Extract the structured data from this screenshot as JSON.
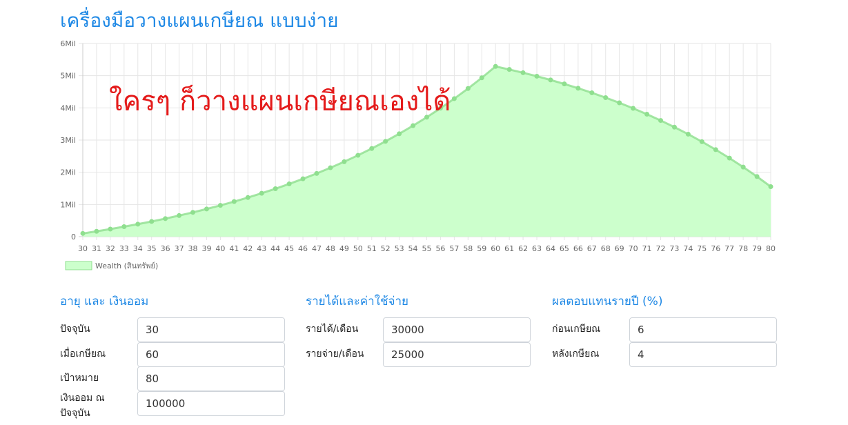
{
  "page": {
    "title": "เครื่องมือวางแผนเกษียณ แบบง่าย",
    "overlay_text": "ใครๆ ก็วางแผนเกษียณเองได้"
  },
  "chart_data": {
    "type": "area",
    "xlabel": "",
    "ylabel": "",
    "ylim": [
      0,
      6000000
    ],
    "y_ticks": [
      "0",
      "1Mil",
      "2Mil",
      "3Mil",
      "4Mil",
      "5Mil",
      "6Mil"
    ],
    "x": [
      30,
      31,
      32,
      33,
      34,
      35,
      36,
      37,
      38,
      39,
      40,
      41,
      42,
      43,
      44,
      45,
      46,
      47,
      48,
      49,
      50,
      51,
      52,
      53,
      54,
      55,
      56,
      57,
      58,
      59,
      60,
      61,
      62,
      63,
      64,
      65,
      66,
      67,
      68,
      69,
      70,
      71,
      72,
      73,
      74,
      75,
      76,
      77,
      78,
      79,
      80
    ],
    "series": [
      {
        "name": "Wealth (สินทรัพย์)",
        "color": "#8fdf8f",
        "fill": "#ccffcc",
        "values": [
          100000,
          166000,
          236000,
          310000,
          389000,
          472000,
          561000,
          655000,
          754000,
          860000,
          971000,
          1090000,
          1215000,
          1348000,
          1489000,
          1638000,
          1796000,
          1963000,
          2141000,
          2328000,
          2527000,
          2738000,
          2960000,
          3196000,
          3446000,
          3710000,
          3990000,
          4287000,
          4601000,
          4934000,
          5287000,
          5193000,
          5091000,
          4983000,
          4867000,
          4743000,
          4610000,
          4469000,
          4318000,
          4157000,
          3985000,
          3803000,
          3609000,
          3402000,
          3183000,
          2950000,
          2703000,
          2441000,
          2162000,
          1867000,
          1554000
        ]
      }
    ],
    "legend": "bottom-left",
    "grid": true
  },
  "sections": {
    "age": {
      "title": "อายุ และ เงินออม",
      "fields": [
        {
          "label": "ปัจจุบัน",
          "value": "30"
        },
        {
          "label": "เมื่อเกษียณ",
          "value": "60"
        },
        {
          "label": "เป้าหมาย",
          "value": "80"
        },
        {
          "label": "เงินออม ณ ปัจจุบัน",
          "value": "100000"
        }
      ]
    },
    "income": {
      "title": "รายได้และค่าใช้จ่าย",
      "fields": [
        {
          "label": "รายได้/เดือน",
          "value": "30000"
        },
        {
          "label": "รายจ่าย/เดือน",
          "value": "25000"
        }
      ]
    },
    "returns": {
      "title": "ผลตอบแทนรายปี (%)",
      "fields": [
        {
          "label": "ก่อนเกษียณ",
          "value": "6"
        },
        {
          "label": "หลังเกษียณ",
          "value": "4"
        }
      ]
    }
  }
}
